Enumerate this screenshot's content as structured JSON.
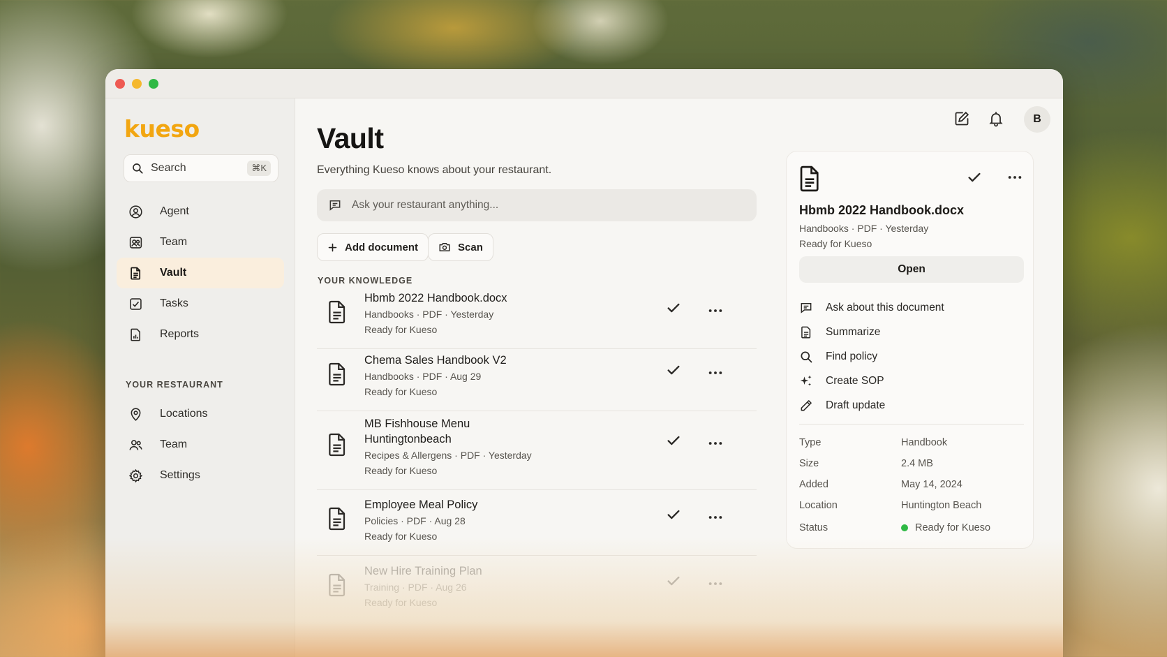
{
  "app": {
    "logo": "kueso"
  },
  "search": {
    "label": "Search",
    "shortcut": "⌘K"
  },
  "sidebar": {
    "items": [
      {
        "label": "Agent",
        "icon": "agent-icon"
      },
      {
        "label": "Team",
        "icon": "team-icon"
      },
      {
        "label": "Vault",
        "icon": "vault-icon",
        "active": true
      },
      {
        "label": "Tasks",
        "icon": "tasks-icon"
      },
      {
        "label": "Reports",
        "icon": "reports-icon"
      }
    ],
    "section_label": "YOUR RESTAURANT",
    "restaurant_items": [
      {
        "label": "Locations",
        "icon": "location-pin-icon"
      },
      {
        "label": "Team",
        "icon": "people-icon"
      },
      {
        "label": "Settings",
        "icon": "gear-icon"
      }
    ]
  },
  "header": {
    "avatar_initial": "B"
  },
  "main": {
    "title": "Vault",
    "subtitle": "Everything Kueso knows about your restaurant.",
    "ask_placeholder": "Ask your restaurant anything...",
    "add_document_label": "Add document",
    "scan_label": "Scan",
    "knowledge_label": "YOUR KNOWLEDGE",
    "documents": [
      {
        "name": "Hbmb 2022 Handbook.docx",
        "meta": "Handbooks · PDF · Yesterday",
        "status": "Ready for Kueso"
      },
      {
        "name": "Chema Sales Handbook V2",
        "meta": "Handbooks · PDF · Aug 29",
        "status": "Ready for Kueso"
      },
      {
        "name": "MB Fishhouse Menu Huntingtonbeach",
        "meta": "Recipes & Allergens  ·  PDF  ·  Yesterday",
        "status": "Ready for Kueso"
      },
      {
        "name": "Employee Meal Policy",
        "meta": "Policies  ·  PDF  ·  Aug 28",
        "status": "Ready for Kueso"
      },
      {
        "name": "New Hire Training Plan",
        "meta": "Training  ·  PDF  ·  Aug 26",
        "status": "Ready for Kueso"
      }
    ]
  },
  "panel": {
    "name": "Hbmb 2022 Handbook.docx",
    "meta": "Handbooks · PDF · Yesterday",
    "status": "Ready for Kueso",
    "open_label": "Open",
    "actions": [
      {
        "label": "Ask about this document",
        "icon": "chat-icon"
      },
      {
        "label": "Summarize",
        "icon": "document-icon"
      },
      {
        "label": "Find policy",
        "icon": "search-icon"
      },
      {
        "label": "Create SOP",
        "icon": "sparkle-icon"
      },
      {
        "label": "Draft update",
        "icon": "pencil-icon"
      }
    ],
    "properties": [
      {
        "key": "Type",
        "value": "Handbook"
      },
      {
        "key": "Size",
        "value": "2.4 MB"
      },
      {
        "key": "Added",
        "value": "May 14, 2024"
      },
      {
        "key": "Location",
        "value": "Huntington Beach"
      },
      {
        "key": "Status",
        "value": "Ready for Kueso"
      }
    ]
  },
  "colors": {
    "brand": "#f2a611",
    "active_nav": "#faeedd",
    "status_green": "#2fb945"
  }
}
